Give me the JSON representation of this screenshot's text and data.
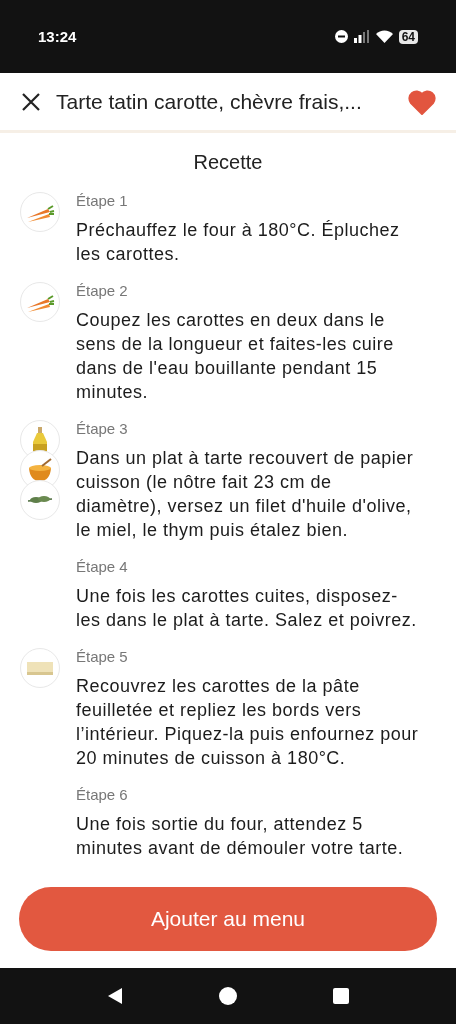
{
  "status_bar": {
    "time": "13:24",
    "battery": "64"
  },
  "header": {
    "title": "Tarte tatin carotte, chèvre frais,...",
    "favorite": true
  },
  "section_title": "Recette",
  "steps": [
    {
      "label": "Étape 1",
      "text": "Préchauffez le four à 180°C. Épluchez les carottes.",
      "ingredients": [
        {
          "kind": "carrot"
        }
      ]
    },
    {
      "label": "Étape 2",
      "text": "Coupez les carottes en deux dans le sens de la longueur et faites-les cuire dans de l'eau bouillante pendant 15 minutes.",
      "ingredients": [
        {
          "kind": "carrot"
        }
      ]
    },
    {
      "label": "Étape 3",
      "text": "Dans un plat à tarte recouvert de papier cuisson (le nôtre fait 23 cm de diamètre), versez un filet d'huile d'olive, le miel, le thym puis étalez bien.",
      "ingredients": [
        {
          "kind": "oil"
        },
        {
          "kind": "honey"
        },
        {
          "kind": "thyme"
        }
      ]
    },
    {
      "label": "Étape 4",
      "text": "Une fois les carottes cuites, disposez-les dans le plat à tarte. Salez et poivrez."
    },
    {
      "label": "Étape 5",
      "text": "Recouvrez les carottes de la pâte feuilletée et repliez les bords vers l’intérieur. Piquez-la puis enfournez pour 20 minutes de cuisson à 180°C.",
      "ingredients": [
        {
          "kind": "pastry"
        }
      ]
    },
    {
      "label": "Étape 6",
      "text": "Une fois sortie du four, attendez 5 minutes avant de démouler votre tarte."
    }
  ],
  "primary_button": "Ajouter au menu"
}
